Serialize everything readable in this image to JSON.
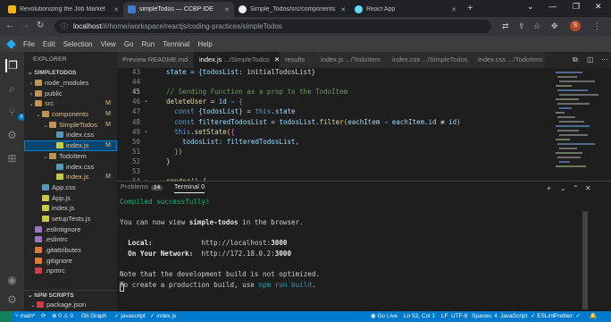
{
  "browser": {
    "tabs": [
      {
        "title": "Revolutionizing the Job Market",
        "favicon_color": "#f4b400"
      },
      {
        "title": "simpleTodos — CCBP IDE",
        "favicon_color": "#3c78d8"
      },
      {
        "title": "Simple_Todos/src/components",
        "favicon_color": "#e8eaed"
      },
      {
        "title": "React App",
        "favicon_color": "#61dafb"
      }
    ],
    "url_host": "localhost",
    "url_path": "/#/home/workspace/reactjs/coding-practices/simpleTodos",
    "profile_initial": "S"
  },
  "menu": [
    "File",
    "Edit",
    "Selection",
    "View",
    "Go",
    "Run",
    "Terminal",
    "Help"
  ],
  "activity": {
    "scm_badge": "9"
  },
  "sidebar": {
    "title": "EXPLORER",
    "section_project": "SIMPLETODOS",
    "tree": [
      {
        "label": "node_modules",
        "indent": 0,
        "folder": true,
        "open": false,
        "status": "",
        "state": ""
      },
      {
        "label": "public",
        "indent": 0,
        "folder": true,
        "open": false,
        "status": "",
        "state": ""
      },
      {
        "label": "src",
        "indent": 0,
        "folder": true,
        "open": true,
        "status": "M",
        "state": "mod"
      },
      {
        "label": "components",
        "indent": 1,
        "folder": true,
        "open": true,
        "status": "M",
        "state": "mod"
      },
      {
        "label": "SimpleTodos",
        "indent": 2,
        "folder": true,
        "open": true,
        "status": "M",
        "state": "mod"
      },
      {
        "label": "index.css",
        "indent": 3,
        "folder": false,
        "icon": "#519aba",
        "status": "",
        "state": ""
      },
      {
        "label": "index.js",
        "indent": 3,
        "folder": false,
        "icon": "#cbcb41",
        "status": "M",
        "state": "mod",
        "selected": true
      },
      {
        "label": "TodoItem",
        "indent": 2,
        "folder": true,
        "open": true,
        "status": "",
        "state": ""
      },
      {
        "label": "index.css",
        "indent": 3,
        "folder": false,
        "icon": "#519aba",
        "status": "",
        "state": ""
      },
      {
        "label": "index.js",
        "indent": 3,
        "folder": false,
        "icon": "#cbcb41",
        "status": "M",
        "state": "mod"
      },
      {
        "label": "App.css",
        "indent": 1,
        "folder": false,
        "icon": "#519aba",
        "status": "",
        "state": ""
      },
      {
        "label": "App.js",
        "indent": 1,
        "folder": false,
        "icon": "#cbcb41",
        "status": "",
        "state": ""
      },
      {
        "label": "index.js",
        "indent": 1,
        "folder": false,
        "icon": "#cbcb41",
        "status": "",
        "state": ""
      },
      {
        "label": "setupTests.js",
        "indent": 1,
        "folder": false,
        "icon": "#cbcb41",
        "status": "",
        "state": ""
      },
      {
        "label": ".eslintignore",
        "indent": 0,
        "folder": false,
        "icon": "#a074c4",
        "status": "",
        "state": ""
      },
      {
        "label": ".eslintrc",
        "indent": 0,
        "folder": false,
        "icon": "#a074c4",
        "status": "",
        "state": ""
      },
      {
        "label": ".gitattributes",
        "indent": 0,
        "folder": false,
        "icon": "#e37933",
        "status": "",
        "state": ""
      },
      {
        "label": ".gitignore",
        "indent": 0,
        "folder": false,
        "icon": "#e37933",
        "status": "",
        "state": ""
      },
      {
        "label": ".npmrc",
        "indent": 0,
        "folder": false,
        "icon": "#cc3e44",
        "status": "",
        "state": ""
      }
    ],
    "section_npm": "NPM SCRIPTS",
    "npm_tree": [
      {
        "label": "package.json",
        "icon": "#cc3e44"
      },
      {
        "label": "start",
        "icon": "#cccccc"
      }
    ]
  },
  "editor_tabs": [
    {
      "label": "Preview README.md",
      "dim": ""
    },
    {
      "label": "index.js",
      "dim": ".../SimpleTodos",
      "active": true
    },
    {
      "label": "results",
      "dim": ""
    },
    {
      "label": "index.js",
      "dim": ".../TodoItem"
    },
    {
      "label": "index.css",
      "dim": ".../SimpleTodos"
    },
    {
      "label": "index.css",
      "dim": ".../TodoItem"
    }
  ],
  "code_lines": [
    {
      "n": "43",
      "tokens": [
        [
          "  state = {",
          "vr"
        ],
        [
          "todosList",
          "vr"
        ],
        [
          ": initialTodosList}",
          "pu"
        ]
      ]
    },
    {
      "n": "44",
      "tokens": []
    },
    {
      "n": "45",
      "tokens": [
        [
          "  // Sending Function as a prop to the TodoItem",
          "cm"
        ]
      ],
      "current": true
    },
    {
      "n": "46",
      "tokens": [
        [
          "  ",
          "pu"
        ],
        [
          "deleteUser",
          "fn"
        ],
        [
          " = ",
          "pu"
        ],
        [
          "id",
          "vr"
        ],
        [
          " ⇒ {",
          "kw"
        ]
      ]
    },
    {
      "n": "47",
      "tokens": [
        [
          "    ",
          "pu"
        ],
        [
          "const",
          "kw"
        ],
        [
          " {",
          "pu"
        ],
        [
          "todosList",
          "vr"
        ],
        [
          "} = ",
          "pu"
        ],
        [
          "this",
          "kw"
        ],
        [
          ".",
          "pu"
        ],
        [
          "state",
          "vr"
        ]
      ]
    },
    {
      "n": "48",
      "tokens": [
        [
          "    ",
          "pu"
        ],
        [
          "const",
          "kw"
        ],
        [
          " ",
          "pu"
        ],
        [
          "filteredTodosList",
          "vr"
        ],
        [
          " = ",
          "pu"
        ],
        [
          "todosList",
          "vr"
        ],
        [
          ".",
          "pu"
        ],
        [
          "filter",
          "fn"
        ],
        [
          "(",
          "br2"
        ],
        [
          "eachItem",
          "vr"
        ],
        [
          " ⇒ ",
          "kw"
        ],
        [
          "eachItem",
          "vr"
        ],
        [
          ".",
          "pu"
        ],
        [
          "id",
          "vr"
        ],
        [
          " ≢ ",
          "pu"
        ],
        [
          "id",
          "vr"
        ],
        [
          ")",
          "br2"
        ]
      ]
    },
    {
      "n": "49",
      "tokens": [
        [
          "    ",
          "pu"
        ],
        [
          "this",
          "kw"
        ],
        [
          ".",
          "pu"
        ],
        [
          "setState",
          "fn"
        ],
        [
          "(",
          "br2"
        ],
        [
          "{",
          "br"
        ]
      ]
    },
    {
      "n": "50",
      "tokens": [
        [
          "      ",
          "pu"
        ],
        [
          "todosList",
          "vr"
        ],
        [
          ": ",
          "pu"
        ],
        [
          "filteredTodosList",
          "vr"
        ],
        [
          ",",
          "pu"
        ]
      ]
    },
    {
      "n": "51",
      "tokens": [
        [
          "    ",
          "pu"
        ],
        [
          "}",
          "br"
        ],
        [
          ")",
          "br2"
        ]
      ]
    },
    {
      "n": "52",
      "tokens": [
        [
          "  }",
          "pu"
        ]
      ]
    },
    {
      "n": "53",
      "tokens": []
    },
    {
      "n": "54",
      "tokens": [
        [
          "  ",
          "pu"
        ],
        [
          "render",
          "fn"
        ],
        [
          "() {",
          "pu"
        ]
      ]
    },
    {
      "n": "55",
      "tokens": [
        [
          "    ",
          "pu"
        ],
        [
          "const",
          "kw"
        ],
        [
          " {",
          "pu"
        ],
        [
          "todosList",
          "vr"
        ],
        [
          "} = ",
          "pu"
        ],
        [
          "this",
          "kw"
        ],
        [
          ".",
          "pu"
        ],
        [
          "state",
          "vr"
        ]
      ]
    }
  ],
  "panel": {
    "problems_label": "Problems",
    "problems_count": "14",
    "terminal_label": "Terminal",
    "terminal_index": "0",
    "lines": [
      [
        [
          "Compiled successfully!",
          "tg"
        ]
      ],
      [],
      [
        [
          "You can now view ",
          ""
        ],
        [
          "simple-todos",
          "tb"
        ],
        [
          " in the browser.",
          ""
        ]
      ],
      [],
      [
        [
          "  ",
          ""
        ],
        [
          "Local:",
          "tb"
        ],
        [
          "            http://localhost:",
          ""
        ],
        [
          "3000",
          "tb"
        ]
      ],
      [
        [
          "  ",
          ""
        ],
        [
          "On Your Network:",
          "tb"
        ],
        [
          "  http://172.18.0.2:",
          ""
        ],
        [
          "3000",
          "tb"
        ]
      ],
      [],
      [
        [
          "Note that the development build is not optimized.",
          ""
        ]
      ],
      [
        [
          "To create a production build, use ",
          ""
        ],
        [
          "npm run build",
          "tc"
        ],
        [
          ".",
          ""
        ]
      ]
    ]
  },
  "status": {
    "branch": "main*",
    "sync": "⟳",
    "errors": "0",
    "warnings": "0",
    "git_graph": "Git Graph",
    "lang_mode": "javascript",
    "file": "index.js",
    "go_live": "Go Live",
    "position": "Ln 53, Col 1",
    "eol": "LF",
    "encoding": "UTF-8",
    "spaces": "Spaces: 4",
    "language": "JavaScript",
    "eslint": "ESLint",
    "prettier": "Prettier: ✓"
  }
}
